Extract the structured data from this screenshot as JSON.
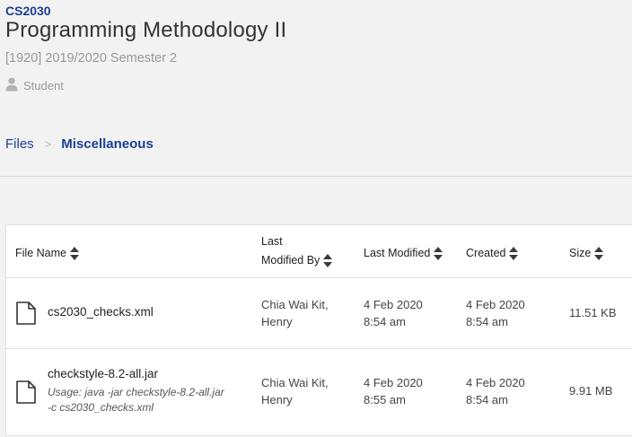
{
  "course": {
    "code": "CS2030",
    "title": "Programming Methodology II",
    "term": "[1920] 2019/2020 Semester 2",
    "role": "Student"
  },
  "breadcrumb": {
    "root": "Files",
    "separator": ">",
    "current": "Miscellaneous"
  },
  "table": {
    "headers": {
      "file_name": "File Name",
      "last_modified_by_line1": "Last",
      "last_modified_by_line2": "Modified By",
      "last_modified": "Last Modified",
      "created": "Created",
      "size": "Size"
    },
    "rows": [
      {
        "file_name": "cs2030_checks.xml",
        "usage_line1": "",
        "usage_line2": "",
        "modified_by_line1": "Chia Wai Kit,",
        "modified_by_line2": "Henry",
        "last_modified_date": "4 Feb 2020",
        "last_modified_time": "8:54 am",
        "created_date": "4 Feb 2020",
        "created_time": "8:54 am",
        "size": "11.51 KB"
      },
      {
        "file_name": "checkstyle-8.2-all.jar",
        "usage_line1": "Usage: java -jar checkstyle-8.2-all.jar",
        "usage_line2": "-c cs2030_checks.xml",
        "modified_by_line1": "Chia Wai Kit,",
        "modified_by_line2": "Henry",
        "last_modified_date": "4 Feb 2020",
        "last_modified_time": "8:55 am",
        "created_date": "4 Feb 2020",
        "created_time": "8:54 am",
        "size": "9.91 MB"
      }
    ]
  },
  "icons": {
    "role": "user-icon",
    "file": "file-icon",
    "sort": "sort-icon"
  },
  "colors": {
    "brand": "#1c3f94",
    "muted": "#999999",
    "background": "#f2f2f2"
  }
}
